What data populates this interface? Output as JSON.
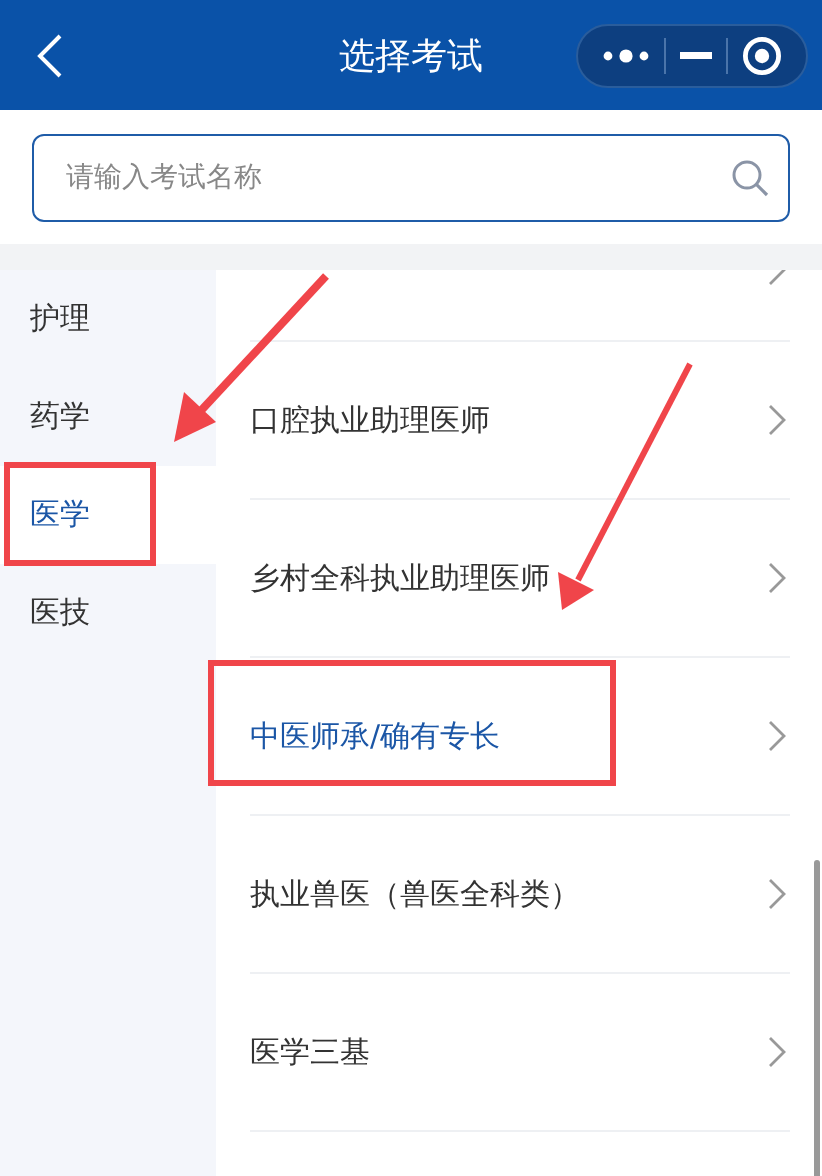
{
  "header": {
    "title": "选择考试"
  },
  "search": {
    "placeholder": "请输入考试名称"
  },
  "sidebar": {
    "items": [
      {
        "label": "护理",
        "selected": false
      },
      {
        "label": "药学",
        "selected": false
      },
      {
        "label": "医学",
        "selected": true
      },
      {
        "label": "医技",
        "selected": false
      }
    ]
  },
  "list": {
    "items": [
      {
        "label": "口腔执业助理医师",
        "selected": false
      },
      {
        "label": "乡村全科执业助理医师",
        "selected": false
      },
      {
        "label": "中医师承/确有专长",
        "selected": true
      },
      {
        "label": "执业兽医（兽医全科类）",
        "selected": false
      },
      {
        "label": "医学三基",
        "selected": false
      }
    ]
  }
}
